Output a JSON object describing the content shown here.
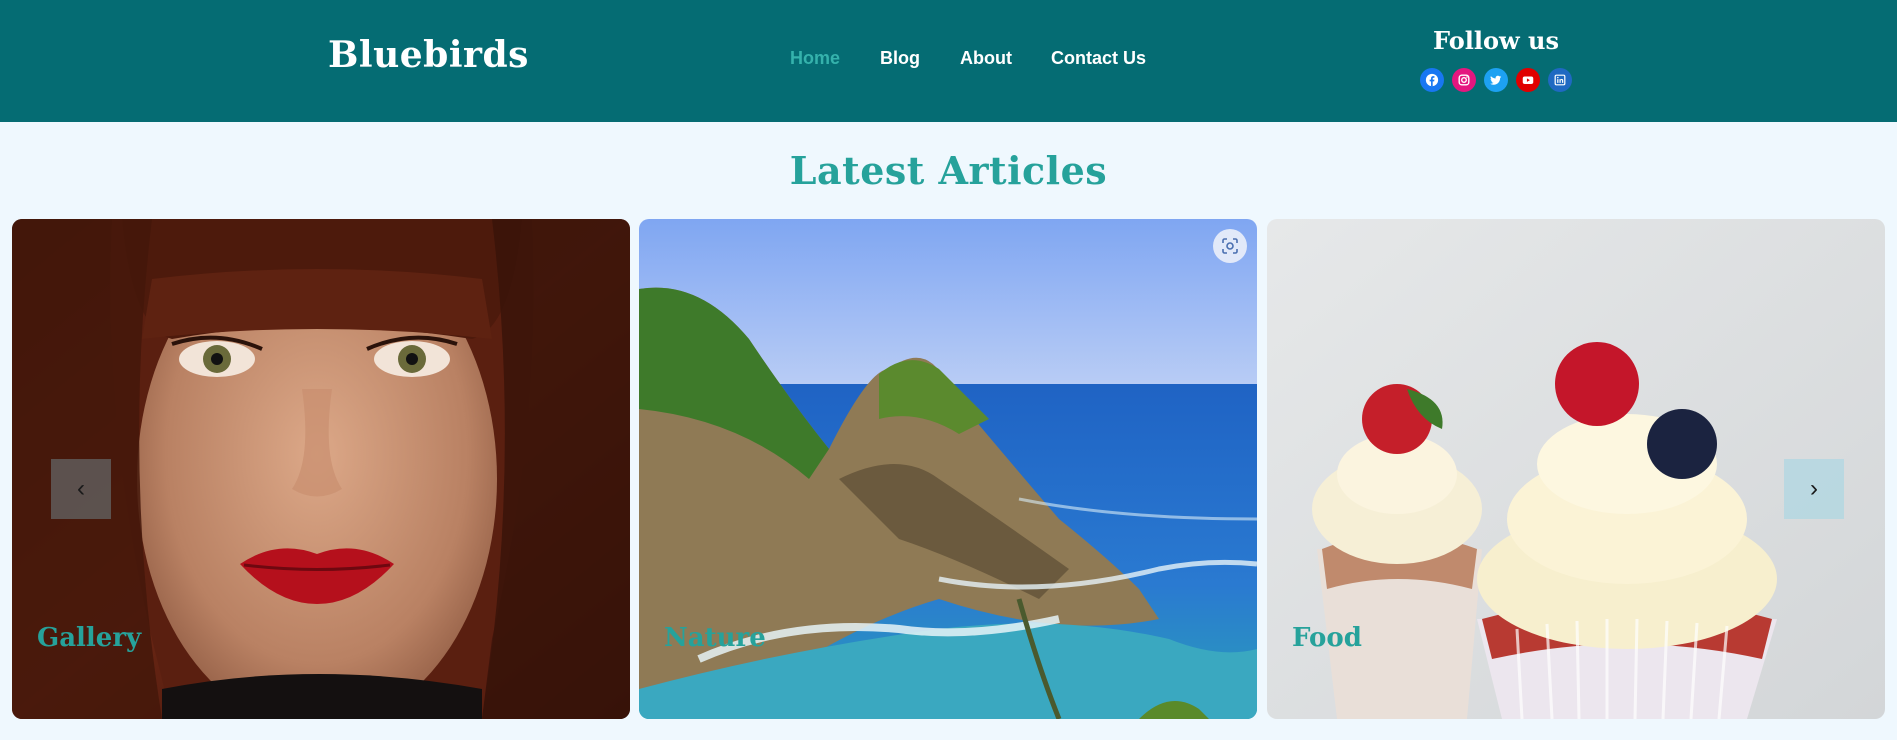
{
  "header": {
    "logo": "Bluebirds",
    "nav": [
      {
        "label": "Home",
        "active": true
      },
      {
        "label": "Blog",
        "active": false
      },
      {
        "label": "About",
        "active": false
      },
      {
        "label": "Contact Us",
        "active": false
      }
    ],
    "follow_title": "Follow us",
    "social": [
      {
        "icon": "facebook-icon",
        "color": "#1877f2"
      },
      {
        "icon": "instagram-icon",
        "color": "#e4167f"
      },
      {
        "icon": "twitter-icon",
        "color": "#1da1f2"
      },
      {
        "icon": "youtube-icon",
        "color": "#e00000"
      },
      {
        "icon": "linkedin-icon",
        "color": "#1f69c2"
      }
    ]
  },
  "main": {
    "title": "Latest Articles",
    "cards": [
      {
        "label": "Gallery",
        "image": "portrait-woman-red-lips"
      },
      {
        "label": "Nature",
        "image": "sea-cliffs-ocean"
      },
      {
        "label": "Food",
        "image": "cupcakes-berries"
      }
    ],
    "prev_label": "‹",
    "next_label": "›"
  },
  "colors": {
    "header_bg": "#056c73",
    "accent": "#26a29b",
    "page_bg": "#eff8fe"
  }
}
